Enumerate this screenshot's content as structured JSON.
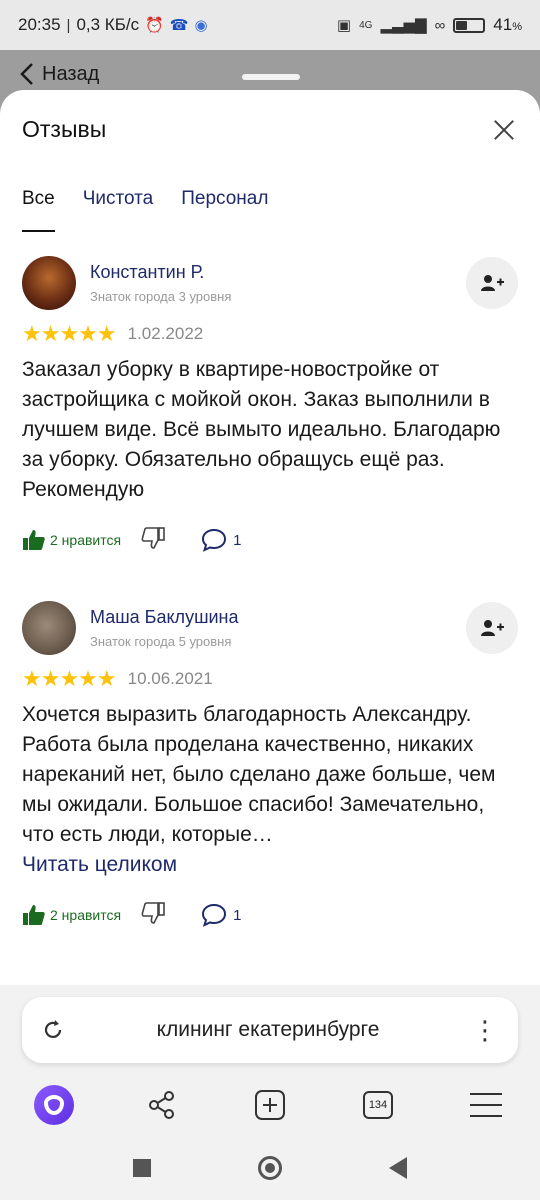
{
  "status_bar": {
    "time": "20:35",
    "net_speed": "0,3 КБ/с",
    "network_badge": "4G",
    "battery": "41",
    "battery_unit": "%",
    "battery_level": 0.41
  },
  "nav": {
    "back_label": "Назад"
  },
  "sheet": {
    "title": "Отзывы"
  },
  "tabs": [
    {
      "label": "Все",
      "active": true
    },
    {
      "label": "Чистота",
      "active": false
    },
    {
      "label": "Персонал",
      "active": false
    }
  ],
  "reviews": [
    {
      "author": "Константин Р.",
      "level": "Знаток города 3 уровня",
      "rating": 5,
      "date": "1.02.2022",
      "text": "Заказал уборку в квартире-новостройке от застройщика с мойкой окон. Заказ выполнили в лучшем виде. Всё вымыто идеально. Благодарю за уборку. Обязательно обращусь ещё раз. Рекомендую",
      "likes": "2 нравится",
      "comments": "1"
    },
    {
      "author": "Маша Баклушина",
      "level": "Знаток города 5 уровня",
      "rating": 5,
      "date": "10.06.2021",
      "text": "Хочется выразить благодарность Александру. Работа была проделана качественно, никаких нареканий нет, было сделано даже больше, чем мы ожидали. Большое спасибо! Замечательно, что есть люди, которые…",
      "read_more": "Читать целиком",
      "likes": "2 нравится",
      "comments": "1"
    }
  ],
  "address_bar": {
    "query": "клининг екатеринбурге"
  },
  "toolbar": {
    "tabs_count": "134"
  },
  "colors": {
    "accent": "#1f2a6b",
    "star": "#ffc20a",
    "like": "#1a6b1f",
    "alice": "#7b4dff"
  }
}
